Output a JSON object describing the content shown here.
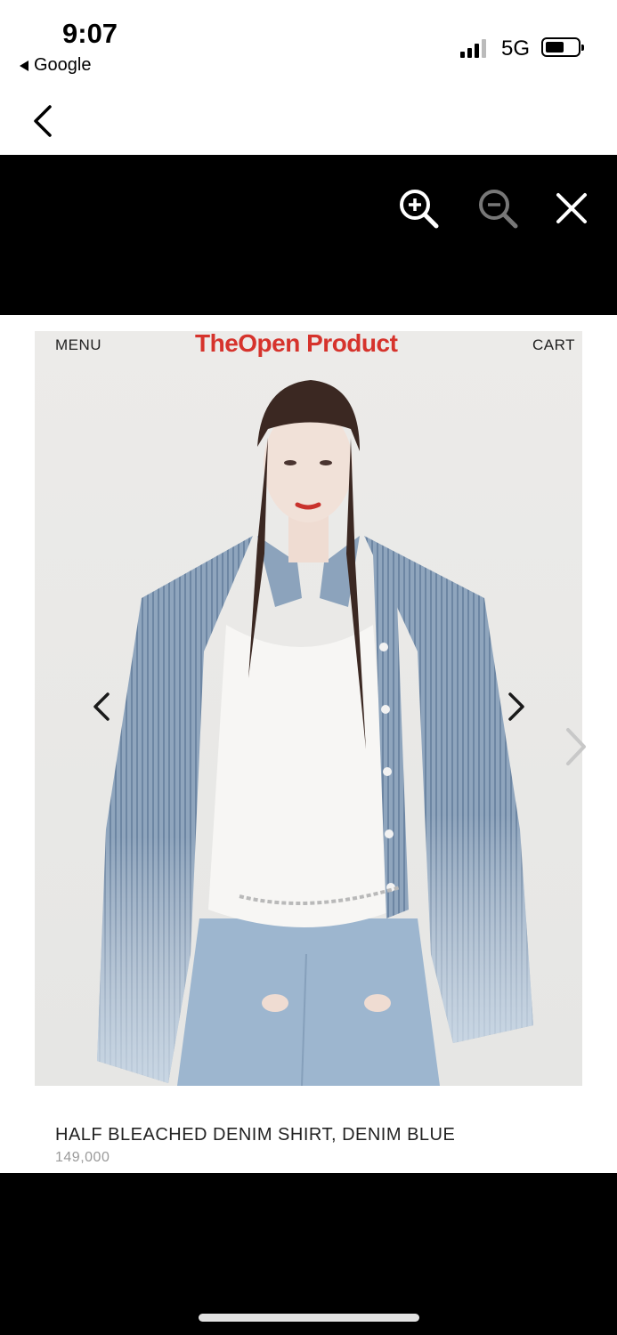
{
  "status": {
    "time": "9:07",
    "back_app": "Google",
    "network": "5G"
  },
  "viewer": {
    "icons": [
      "zoom-in-icon",
      "zoom-out-icon",
      "close-icon"
    ]
  },
  "site": {
    "menu": "MENU",
    "logo": "TheOpen Product",
    "cart": "CART"
  },
  "product": {
    "title": "HALF BLEACHED DENIM SHIRT, DENIM BLUE",
    "price": "149,000"
  },
  "colors": {
    "brand": "#d6332c",
    "viewer_background": "#000000"
  }
}
